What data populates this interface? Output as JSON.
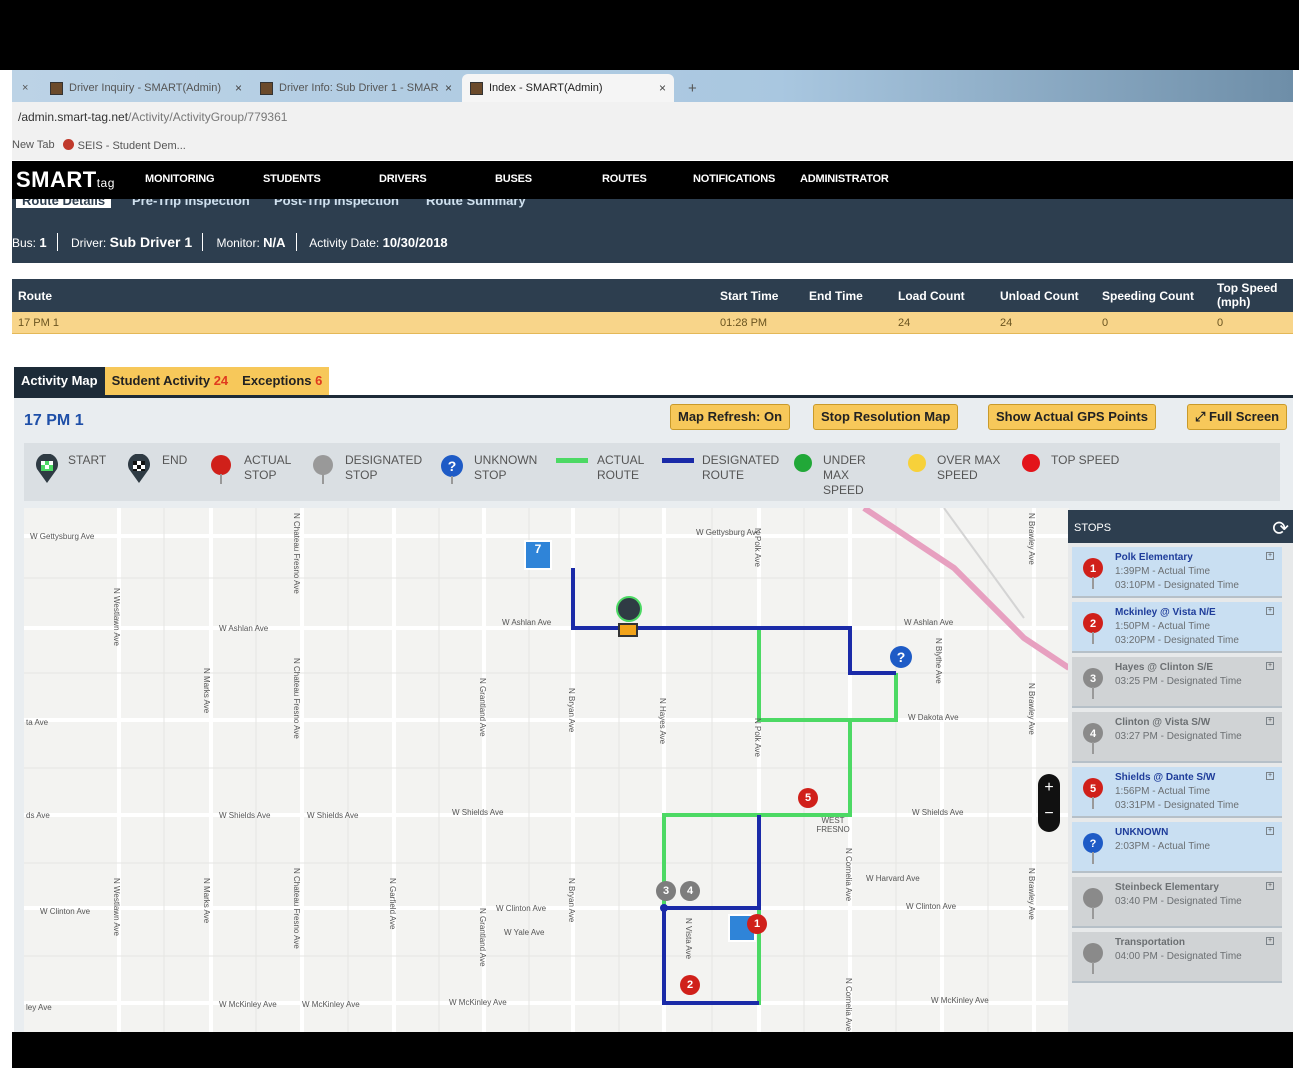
{
  "browser": {
    "tabs": [
      {
        "title": "Driver Inquiry - SMART(Admin)"
      },
      {
        "title": "Driver Info: Sub Driver 1 - SMAR"
      },
      {
        "title": "Index - SMART(Admin)"
      }
    ],
    "address_host": "/admin.smart-tag.net",
    "address_path": "/Activity/ActivityGroup/779361",
    "bookmarks": [
      "New Tab",
      "SEIS - Student Dem..."
    ]
  },
  "app": {
    "logo": "SMART",
    "logo_suffix": "tag",
    "nav": [
      "MONITORING",
      "STUDENTS",
      "DRIVERS",
      "BUSES",
      "ROUTES",
      "NOTIFICATIONS",
      "ADMINISTRATOR"
    ],
    "subtabs": [
      "Route Details",
      "Pre-Trip Inspection",
      "Post-Trip Inspection",
      "Route Summary"
    ]
  },
  "info": {
    "bus_label": "Bus:",
    "bus": "1",
    "driver_label": "Driver:",
    "driver": "Sub Driver 1",
    "monitor_label": "Monitor:",
    "monitor": "N/A",
    "date_label": "Activity Date:",
    "date": "10/30/2018"
  },
  "route_table": {
    "headers": [
      "Route",
      "Start Time",
      "End Time",
      "Load Count",
      "Unload Count",
      "Speeding Count",
      "Top Speed (mph)"
    ],
    "row": [
      "17 PM 1",
      "01:28 PM",
      "",
      "24",
      "24",
      "0",
      "0"
    ]
  },
  "activity_tabs": [
    {
      "label": "Activity Map",
      "count": ""
    },
    {
      "label": "Student Activity",
      "count": "24"
    },
    {
      "label": "Exceptions",
      "count": "6"
    }
  ],
  "map_title": "17 PM 1",
  "buttons": {
    "refresh": "Map Refresh: On",
    "resolution": "Stop Resolution Map",
    "gps": "Show Actual GPS Points",
    "fullscreen": "Full Screen"
  },
  "legend": [
    {
      "label": "START",
      "icon": "start-flag-icon"
    },
    {
      "label": "END",
      "icon": "end-flag-icon"
    },
    {
      "label": "ACTUAL STOP",
      "icon": "red-pin-icon"
    },
    {
      "label": "DESIGNATED STOP",
      "icon": "gray-pin-icon"
    },
    {
      "label": "UNKNOWN STOP",
      "icon": "question-pin-icon"
    },
    {
      "label": "ACTUAL ROUTE",
      "icon": "green-line-icon"
    },
    {
      "label": "DESIGNATED ROUTE",
      "icon": "blue-line-icon"
    },
    {
      "label": "UNDER MAX SPEED",
      "icon": "green-dot-icon"
    },
    {
      "label": "OVER MAX SPEED",
      "icon": "yellow-dot-icon"
    },
    {
      "label": "TOP SPEED",
      "icon": "red-dot-icon"
    }
  ],
  "colors": {
    "actual_route": "#4cd964",
    "designated_route": "#1a2aa8",
    "accent": "#f7c85a",
    "header": "#2d3e4f"
  },
  "streets": {
    "gettysburg": "W Gettysburg Ave",
    "ashlan": "W Ashlan Ave",
    "dakota": "W Dakota Ave",
    "shields": "W Shields Ave",
    "harvard": "W Harvard Ave",
    "clinton": "W Clinton Ave",
    "yale": "W Yale Ave",
    "mckinley": "W McKinley Ave",
    "west_fresno": "WEST FRESNO",
    "polk": "N Polk Ave",
    "hayes": "N Hayes Ave",
    "bryan": "N Bryan Ave",
    "grantland": "N Grantland Ave",
    "cornelia": "N Cornelia Ave",
    "blythe": "N Blythe Ave",
    "brawley": "N Brawley Ave",
    "chateau": "N Chateau Fresno Ave",
    "vista": "N Vista Ave",
    "garfield": "N Garfield Ave",
    "westlawn": "N Westlawn Ave",
    "marks": "N Marks Ave",
    "ta": "ta Ave",
    "ds": "ds Ave",
    "ley": "ley Ave"
  },
  "stops_panel": {
    "title": "STOPS",
    "items": [
      {
        "num": "1",
        "kind": "actual",
        "name": "Polk Elementary",
        "line1": "1:39PM - Actual Time",
        "line2": "03:10PM - Designated Time"
      },
      {
        "num": "2",
        "kind": "actual",
        "name": "Mckinley @ Vista N/E",
        "line1": "1:50PM - Actual Time",
        "line2": "03:20PM - Designated Time"
      },
      {
        "num": "3",
        "kind": "designated",
        "name": "Hayes @ Clinton S/E",
        "line1": "03:25 PM - Designated Time",
        "line2": ""
      },
      {
        "num": "4",
        "kind": "designated",
        "name": "Clinton @ Vista S/W",
        "line1": "03:27 PM - Designated Time",
        "line2": ""
      },
      {
        "num": "5",
        "kind": "actual",
        "name": "Shields @ Dante S/W",
        "line1": "1:56PM - Actual Time",
        "line2": "03:31PM - Designated Time"
      },
      {
        "num": "?",
        "kind": "unknown",
        "name": "UNKNOWN",
        "line1": "2:03PM - Actual Time",
        "line2": ""
      },
      {
        "num": "",
        "kind": "designated",
        "name": "Steinbeck Elementary",
        "line1": "03:40 PM - Designated Time",
        "line2": ""
      },
      {
        "num": "",
        "kind": "designated",
        "name": "Transportation",
        "line1": "04:00 PM - Designated Time",
        "line2": ""
      }
    ]
  },
  "map_markers": {
    "school_a": "7",
    "stop1": "1",
    "stop2": "2",
    "stop3": "3",
    "stop4": "4",
    "stop5": "5",
    "unknown": "?"
  }
}
